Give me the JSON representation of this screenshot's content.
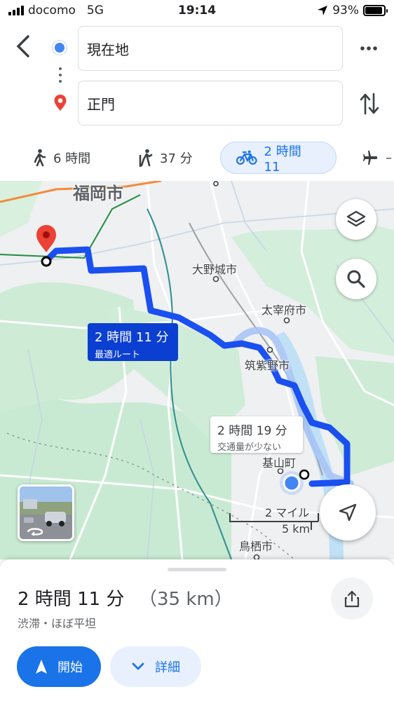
{
  "status_bar": {
    "carrier": "docomo",
    "network": "5G",
    "time": "19:14",
    "battery": "93%",
    "battery_level": 0.93,
    "icons": [
      "signal-icon",
      "location-arrow-icon",
      "battery-icon"
    ]
  },
  "search": {
    "origin": "現在地",
    "destination": "正門",
    "icons": [
      "back-icon",
      "origin-dot-icon",
      "destination-pin-icon",
      "more-icon",
      "swap-icon"
    ]
  },
  "modes": [
    {
      "icon": "walk-icon",
      "label": "6 時間",
      "selected": false
    },
    {
      "icon": "transit-walk-icon",
      "label": "37 分",
      "selected": false
    },
    {
      "icon": "bicycle-icon",
      "label": "2 時間 11",
      "selected": true
    },
    {
      "icon": "flight-icon",
      "label": "–",
      "selected": false
    }
  ],
  "map": {
    "places": [
      "福岡市",
      "大野城市",
      "太宰府市",
      "筑紫野市",
      "基山町",
      "鳥栖市"
    ],
    "route_label": {
      "time": "2 時間 11 分",
      "note": "最適ルート"
    },
    "alt_route_label": {
      "time": "2 時間 19 分",
      "note": "交通量が少ない"
    },
    "scale": {
      "miles": "2 マイル",
      "km": "5 km"
    },
    "colors": {
      "route": "#1a4ff0",
      "alt_route": "#a9c4f5",
      "water": "#aadaff",
      "park": "#c8ead2",
      "origin": "#4285f4",
      "destination": "#ea4335"
    }
  },
  "sheet": {
    "duration": "2 時間 11 分",
    "distance": "（35 km）",
    "description": "渋滞・ほぼ平坦",
    "start_label": "開始",
    "detail_label": "詳細"
  }
}
